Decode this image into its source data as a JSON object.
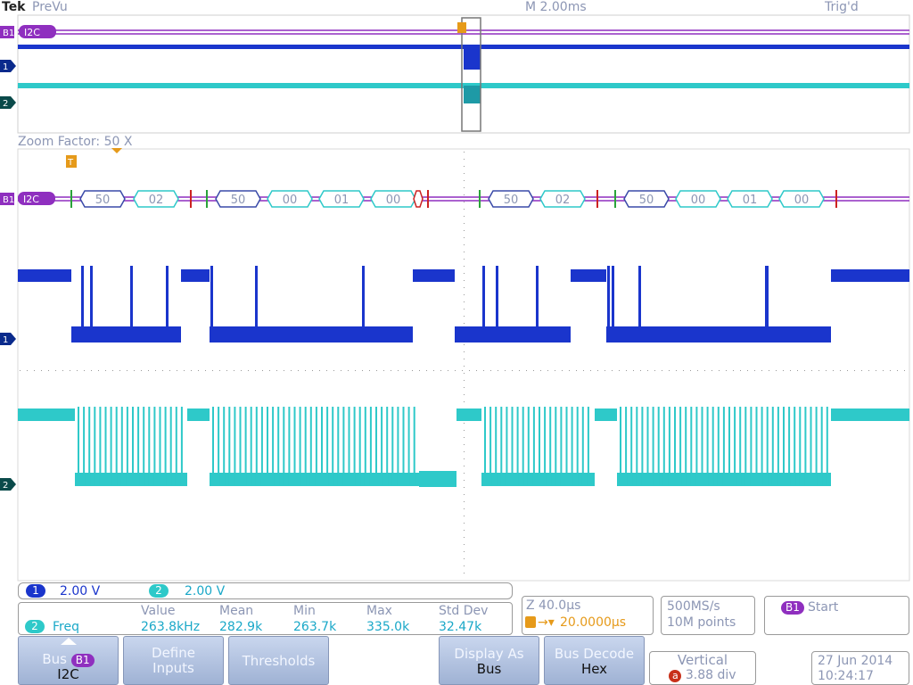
{
  "header": {
    "brand": "Tek",
    "mode": "PreVu",
    "timebase": "M 2.00ms",
    "trigger_status": "Trig'd"
  },
  "zoom": {
    "label": "Zoom Factor: 50 X"
  },
  "bus": {
    "label": "B1",
    "protocol": "I2C",
    "packets_overview": [],
    "packets": [
      {
        "group": 1,
        "bytes": [
          {
            "text": "50",
            "kind": "address"
          },
          {
            "text": "02",
            "kind": "data"
          }
        ]
      },
      {
        "group": 2,
        "bytes": [
          {
            "text": "50",
            "kind": "address"
          },
          {
            "text": "00",
            "kind": "data"
          },
          {
            "text": "01",
            "kind": "data"
          },
          {
            "text": "00",
            "kind": "data"
          }
        ]
      },
      {
        "group": 3,
        "bytes": [
          {
            "text": "50",
            "kind": "address"
          },
          {
            "text": "02",
            "kind": "data"
          }
        ]
      },
      {
        "group": 4,
        "bytes": [
          {
            "text": "50",
            "kind": "address"
          },
          {
            "text": "00",
            "kind": "data"
          },
          {
            "text": "01",
            "kind": "data"
          },
          {
            "text": "00",
            "kind": "data"
          }
        ]
      }
    ]
  },
  "channels": [
    {
      "id": "1",
      "color": "#1a35cc",
      "scale": "2.00 V"
    },
    {
      "id": "2",
      "color": "#2ec9c9",
      "scale": "2.00 V"
    }
  ],
  "measurement": {
    "source": "2",
    "name": "Freq",
    "headers": [
      "Value",
      "Mean",
      "Min",
      "Max",
      "Std Dev"
    ],
    "values": [
      "263.8kHz",
      "282.9k",
      "263.7k",
      "335.0k",
      "32.47k"
    ]
  },
  "zoom_info": {
    "scale": "Z 40.0µs",
    "position": "20.0000µs"
  },
  "acquisition": {
    "rate": "500MS/s",
    "points": "10M points"
  },
  "trigger": {
    "source": "B1",
    "type": "Start"
  },
  "buttons": {
    "bus": {
      "line1": "Bus",
      "badge": "B1",
      "line2": "I2C"
    },
    "define": {
      "line1": "Define",
      "line2": "Inputs"
    },
    "thresholds": {
      "line1": "Thresholds"
    },
    "display_as": {
      "line1": "Display As",
      "line2": "Bus"
    },
    "bus_decode": {
      "line1": "Bus Decode",
      "line2": "Hex"
    }
  },
  "vertical": {
    "title": "Vertical",
    "marker": "a",
    "value": "3.88 div"
  },
  "datetime": {
    "date": "27 Jun  2014",
    "time": "10:24:17"
  },
  "markers": {
    "trigger": "T"
  },
  "colors": {
    "ch1": "#1a35cc",
    "ch2": "#2ec9c9",
    "bus": "#8f2fbf",
    "trigger": "#e69a1a",
    "grid": "#c9c9c9"
  }
}
